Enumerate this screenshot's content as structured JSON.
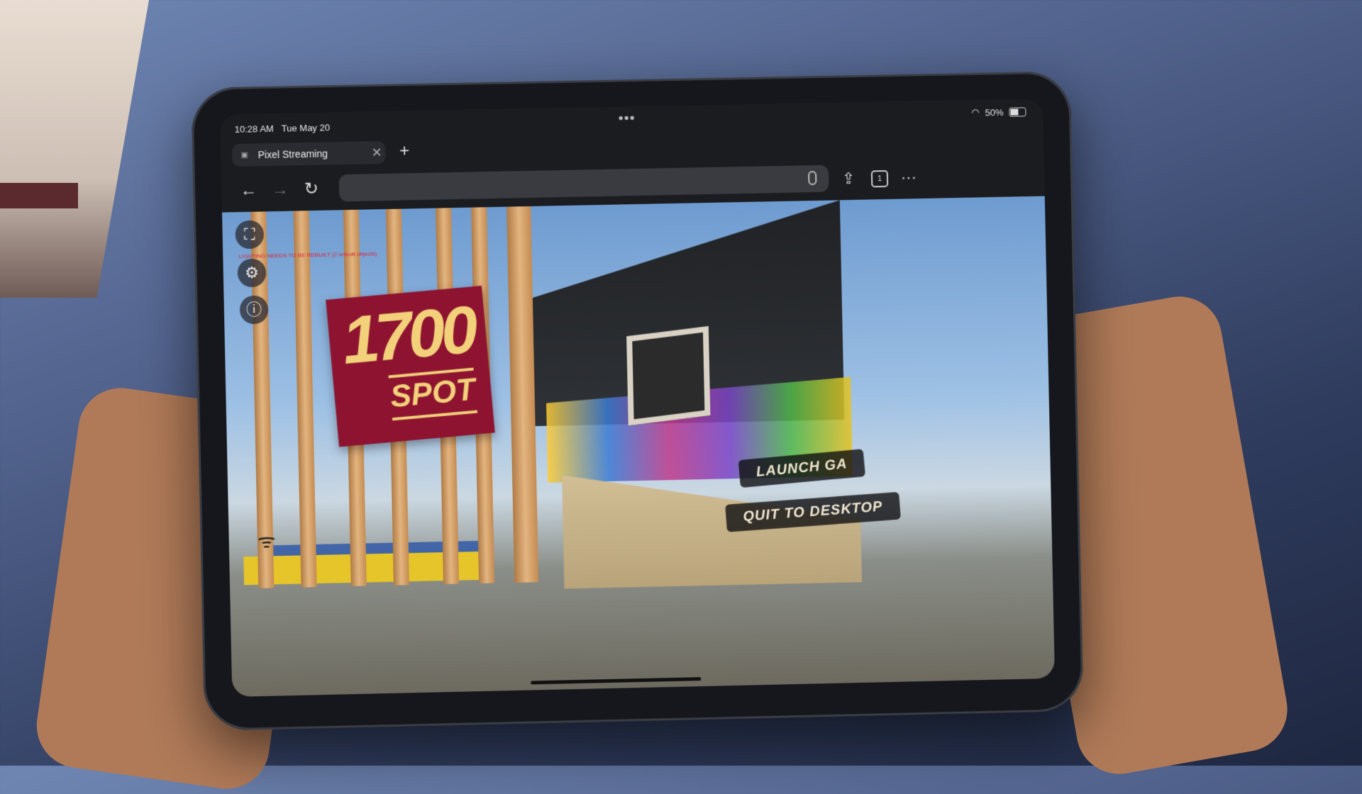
{
  "status": {
    "time": "10:28 AM",
    "date": "Tue May 20",
    "battery": "50%"
  },
  "tab": {
    "title": "Pixel Streaming",
    "close_label": "✕",
    "new_tab_label": "+"
  },
  "toolbar": {
    "back_label": "←",
    "forward_label": "→",
    "reload_label": "↻",
    "url_value": "",
    "share_label": "⇪",
    "tabs_count": "1",
    "more_label": "···"
  },
  "game": {
    "sign_number": "1700",
    "sign_word": "SPOT",
    "warning_text": "LIGHTING NEEDS TO BE REBUILT (2 unbuilt objects)",
    "launch_button": "LAUNCH GA",
    "quit_button": "QUIT TO DESKTOP",
    "fullscreen_icon": "⛶",
    "settings_icon": "⚙",
    "info_icon": "ⓘ",
    "wifi_icon": "ᯤ"
  },
  "icons": {
    "wifi": "wifi-icon",
    "battery": "battery-icon",
    "mic": "mic-icon"
  },
  "colors": {
    "sign": "#8e1330",
    "sign_text": "#f2d17a",
    "browser_chrome": "#1b1c20"
  }
}
